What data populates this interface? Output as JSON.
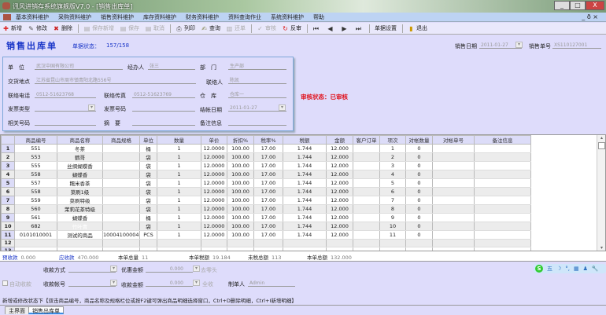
{
  "window": {
    "title": "讯风进销存系统旗舰版V7.0 - [销售出库单]",
    "min": "_",
    "max": "□",
    "close": "X",
    "mdi_controls": [
      "_",
      "ð",
      "×"
    ]
  },
  "menu": [
    "基本资料维护",
    "采购资料维护",
    "销售资料维护",
    "库存资料维护",
    "财务资料维护",
    "资料查询作业",
    "系统资料维护",
    "帮助"
  ],
  "toolbar": [
    {
      "label": "新增",
      "icon": "add-icon",
      "glyph": "✚",
      "color": "#d22",
      "enabled": true
    },
    {
      "label": "修改",
      "icon": "edit-icon",
      "glyph": "✎",
      "color": "#555",
      "enabled": true
    },
    {
      "label": "删除",
      "icon": "delete-icon",
      "glyph": "✖",
      "color": "#c22",
      "enabled": true
    },
    {
      "label": "保存新增",
      "icon": "save-new-icon",
      "glyph": "▤",
      "color": "#aaa",
      "enabled": false
    },
    {
      "label": "保存",
      "icon": "save-icon",
      "glyph": "▤",
      "color": "#aaa",
      "enabled": false
    },
    {
      "label": "取消",
      "icon": "cancel-icon",
      "glyph": "▤",
      "color": "#aaa",
      "enabled": false
    },
    {
      "label": "列印",
      "icon": "print-icon",
      "glyph": "⎙",
      "color": "#555",
      "enabled": true
    },
    {
      "label": "查询",
      "icon": "search-icon",
      "glyph": "✍",
      "color": "#885",
      "enabled": true
    },
    {
      "label": "还单",
      "icon": "return-icon",
      "glyph": "▥",
      "color": "#aaa",
      "enabled": false
    },
    {
      "label": "审核",
      "icon": "audit-icon",
      "glyph": "✓",
      "color": "#aaa",
      "enabled": false
    },
    {
      "label": "反审",
      "icon": "unaudit-icon",
      "glyph": "↻",
      "color": "#d22",
      "enabled": true
    },
    {
      "label": "",
      "icon": "first-record-icon",
      "glyph": "⏮",
      "color": "#333",
      "enabled": true
    },
    {
      "label": "",
      "icon": "prev-record-icon",
      "glyph": "◀",
      "color": "#333",
      "enabled": true
    },
    {
      "label": "",
      "icon": "next-record-icon",
      "glyph": "▶",
      "color": "#333",
      "enabled": true
    },
    {
      "label": "",
      "icon": "last-record-icon",
      "glyph": "⏭",
      "color": "#333",
      "enabled": true
    },
    {
      "label": "单据设置",
      "icon": "",
      "glyph": "",
      "color": "#333",
      "enabled": true
    },
    {
      "label": "退出",
      "icon": "exit-icon",
      "glyph": "▮",
      "color": "#c90",
      "enabled": true
    }
  ],
  "header": {
    "title": "销售出库单",
    "status_label": "单据状态：",
    "status_value": "157/158",
    "date_label": "销售日期",
    "date_value": "2011-01-27",
    "number_label": "销售单号",
    "number_value": "XS110127001",
    "audit_status": "审核状态：已审核"
  },
  "form": {
    "unit_label": "单　位",
    "unit_value": "武汉中国有限公司",
    "handler_label": "经办人",
    "handler_value": "张三",
    "dept_label": "部　门",
    "dept_value": "生产部",
    "address_label": "交货地点",
    "address_value": "江苏省昆山市周市镇青阳北路556号",
    "contact_label": "联络人",
    "contact_value": "陈凯",
    "phone_label": "联络电话",
    "phone_value": "0512-51623768",
    "fax_label": "联络传真",
    "fax_value": "0512-51623769",
    "warehouse_label": "仓　库",
    "warehouse_value": "仓库一",
    "invoice_type_label": "发票类型",
    "invoice_type_value": "",
    "invoice_no_label": "发票号码",
    "invoice_no_value": "",
    "receipt_date_label": "结帐日期",
    "receipt_date_value": "2011-01-27",
    "related_no_label": "相关号码",
    "related_no_value": "",
    "summary_label": "摘　要",
    "summary_value": "",
    "remark_label": "备注信息",
    "remark_value": ""
  },
  "grid": {
    "columns": [
      "",
      "商品编号",
      "商品名称",
      "商品规格",
      "单位",
      "数量",
      "单价",
      "折扣%",
      "税率%",
      "税额",
      "金额",
      "客户订单",
      "项次",
      "对帐数量",
      "对帐单号",
      "备注信息"
    ],
    "rows": [
      [
        "1",
        "551",
        "冬茶",
        "",
        "桶",
        "1",
        "12.0000",
        "100.00",
        "17.00",
        "1.744",
        "12.000",
        "",
        "1",
        "0",
        "",
        ""
      ],
      [
        "2",
        "553",
        "鹦哥",
        "",
        "袋",
        "1",
        "12.0000",
        "100.00",
        "17.00",
        "1.744",
        "12.000",
        "",
        "2",
        "0",
        "",
        ""
      ],
      [
        "3",
        "555",
        "丝绸蝴蝶香",
        "",
        "袋",
        "1",
        "12.0000",
        "100.00",
        "17.00",
        "1.744",
        "12.000",
        "",
        "3",
        "0",
        "",
        ""
      ],
      [
        "4",
        "558",
        "蝴蝶香",
        "",
        "袋",
        "1",
        "12.0000",
        "100.00",
        "17.00",
        "1.744",
        "12.000",
        "",
        "4",
        "0",
        "",
        ""
      ],
      [
        "5",
        "557",
        "糯米香茶",
        "",
        "袋",
        "1",
        "12.0000",
        "100.00",
        "17.00",
        "1.744",
        "12.000",
        "",
        "5",
        "0",
        "",
        ""
      ],
      [
        "6",
        "558",
        "菜刷1级",
        "",
        "袋",
        "1",
        "12.0000",
        "100.00",
        "17.00",
        "1.744",
        "12.000",
        "",
        "6",
        "0",
        "",
        ""
      ],
      [
        "7",
        "559",
        "菜刷特级",
        "",
        "袋",
        "1",
        "12.0000",
        "100.00",
        "17.00",
        "1.744",
        "12.000",
        "",
        "7",
        "0",
        "",
        ""
      ],
      [
        "8",
        "560",
        "茉莉花茶特级",
        "",
        "袋",
        "1",
        "12.0000",
        "100.00",
        "17.00",
        "1.744",
        "12.000",
        "",
        "8",
        "0",
        "",
        ""
      ],
      [
        "9",
        "561",
        "蝴蝶香",
        "",
        "桶",
        "1",
        "12.0000",
        "100.00",
        "17.00",
        "1.744",
        "12.000",
        "",
        "9",
        "0",
        "",
        ""
      ],
      [
        "10",
        "682",
        "竹叶青",
        "",
        "袋",
        "1",
        "12.0000",
        "100.00",
        "17.00",
        "1.744",
        "12.000",
        "",
        "10",
        "0",
        "",
        ""
      ],
      [
        "11",
        "0101010001",
        "测试的商品",
        "100041000040.",
        "PCS",
        "1",
        "12.0000",
        "100.00",
        "17.00",
        "1.744",
        "12.000",
        "",
        "11",
        "0",
        "",
        ""
      ],
      [
        "12",
        "",
        "",
        "",
        "",
        "",
        "",
        "",
        "",
        "",
        "",
        "",
        "",
        "",
        "",
        ""
      ],
      [
        "13",
        "",
        "",
        "",
        "",
        "",
        "",
        "",
        "",
        "",
        "",
        "",
        "",
        "",
        "",
        ""
      ],
      [
        "14",
        "",
        "",
        "",
        "",
        "",
        "",
        "",
        "",
        "",
        "",
        "",
        "",
        "",
        "",
        ""
      ]
    ],
    "selected_row": 10,
    "selected_col": 2
  },
  "totals": [
    {
      "label": "预收款",
      "value": "0.000",
      "blue": true
    },
    {
      "label": "应收款",
      "value": "470.000",
      "blue": true
    },
    {
      "label": "本单总量",
      "value": "11",
      "blue": false
    },
    {
      "label": "本单税额",
      "value": "19.184",
      "blue": false
    },
    {
      "label": "未税总额",
      "value": "113",
      "blue": false
    },
    {
      "label": "本单总额",
      "value": "132.000",
      "blue": false
    }
  ],
  "payment": {
    "method_label": "收款方式",
    "method_value": "",
    "discount_label": "优惠金额",
    "discount_value": "0.000",
    "discount_suffix": "去零头",
    "auto_receipt_label": "自动收款",
    "account_label": "收款帐号",
    "account_value": "",
    "received_label": "收款金额",
    "received_value": "0.000",
    "received_suffix": "全收",
    "creator_label": "制单人",
    "creator_value": "Admin"
  },
  "hint": "新增或修改状态下【双击商品编号，商品名称及规格栏位或按F2键可弹出商品明细选择窗口，Ctrl+D删除明细，Ctrl+I新增明细】",
  "tabs": [
    "主界面",
    "销售出库单"
  ],
  "ime_toolbar": [
    "五",
    "☽",
    "°,",
    "▦",
    "♟",
    "🔧"
  ]
}
